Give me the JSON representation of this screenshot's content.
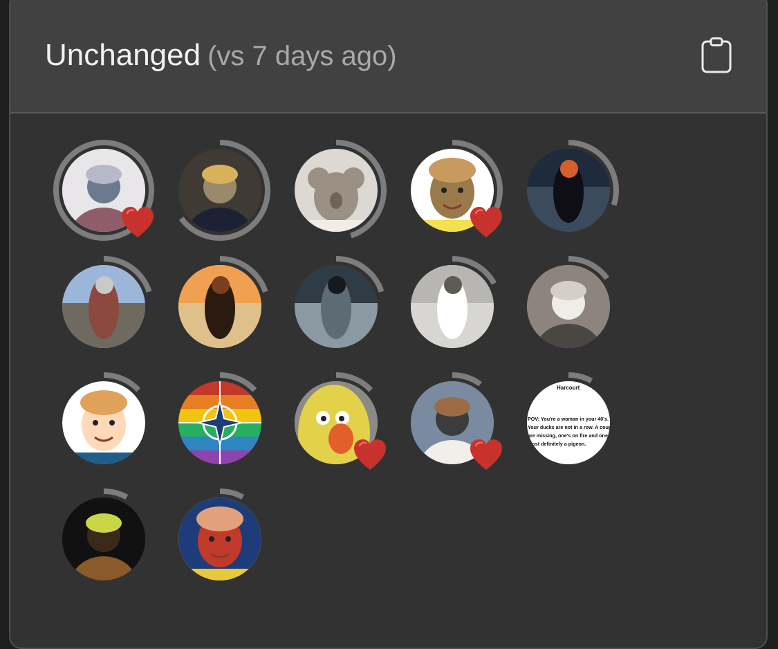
{
  "header": {
    "title": "Unchanged",
    "subtitle": "(vs 7 days ago)",
    "clipboard_icon": "clipboard-icon"
  },
  "colors": {
    "panel_bg": "#323232",
    "header_bg": "#414141",
    "ring_track": "#7d7d7d",
    "heart": "#c8322c"
  },
  "avatars": [
    {
      "ring": 1.0,
      "heart": true,
      "palette": [
        "#e9e6ea",
        "#8f5d69",
        "#b7b9c9",
        "#6b7a8f"
      ],
      "kind": "person"
    },
    {
      "ring": 0.65,
      "heart": false,
      "palette": [
        "#3f3b34",
        "#1c2233",
        "#d8b25a",
        "#9a8a6c"
      ],
      "kind": "person"
    },
    {
      "ring": 0.45,
      "heart": false,
      "palette": [
        "#dcd8d2",
        "#9c8f83",
        "#6e6259",
        "#ece8e3"
      ],
      "kind": "koala"
    },
    {
      "ring": 0.32,
      "heart": true,
      "palette": [
        "#f4e14e",
        "#ffffff",
        "#c89a5e",
        "#9a7a4a"
      ],
      "kind": "cartoon"
    },
    {
      "ring": 0.3,
      "heart": false,
      "palette": [
        "#1f2a3d",
        "#d6602a",
        "#0e0e14",
        "#3c4a5e"
      ],
      "kind": "scene"
    },
    {
      "ring": 0.2,
      "heart": false,
      "palette": [
        "#9bb6d8",
        "#c9c9c7",
        "#8b4a3d",
        "#6f6a60"
      ],
      "kind": "scene"
    },
    {
      "ring": 0.2,
      "heart": false,
      "palette": [
        "#f0a050",
        "#7a3f1e",
        "#2b1a10",
        "#e0c08a"
      ],
      "kind": "scene"
    },
    {
      "ring": 0.2,
      "heart": false,
      "palette": [
        "#2f3b45",
        "#151a1f",
        "#5c6b74",
        "#8b9aa2"
      ],
      "kind": "scene"
    },
    {
      "ring": 0.17,
      "heart": false,
      "palette": [
        "#b8b6b3",
        "#5e5a56",
        "#ffffff",
        "#d8d6d2"
      ],
      "kind": "scene"
    },
    {
      "ring": 0.15,
      "heart": false,
      "palette": [
        "#8d847d",
        "#4a4642",
        "#d6cfc6",
        "#f0ece6"
      ],
      "kind": "person"
    },
    {
      "ring": 0.13,
      "heart": false,
      "palette": [
        "#1f5e8a",
        "#ffffff",
        "#e0a25a",
        "#ffd9b8"
      ],
      "kind": "cartoon"
    },
    {
      "ring": 0.13,
      "heart": false,
      "palette": [
        "#c0392b",
        "#e67e22",
        "#f1c40f",
        "#2e86c1"
      ],
      "kind": "flag"
    },
    {
      "ring": 0.13,
      "heart": true,
      "palette": [
        "#e3d14a",
        "#e25e2a",
        "#ffffff",
        "#2d2d2d"
      ],
      "kind": "muppet"
    },
    {
      "ring": 0.1,
      "heart": true,
      "palette": [
        "#7a8aa0",
        "#f2eee8",
        "#9a6b45",
        "#3c3c3c"
      ],
      "kind": "person"
    },
    {
      "ring": 0.08,
      "heart": false,
      "palette": [
        "#ffffff",
        "#111111",
        "#555555",
        "#222222"
      ],
      "kind": "text",
      "text_lines": [
        "Harcourt",
        "POV: You're a woman in your 40's.",
        "Your ducks are not in a row. A couple",
        "are missing, one's on fire and one is",
        "most definitely a pigeon."
      ]
    },
    {
      "ring": 0.08,
      "heart": false,
      "palette": [
        "#111111",
        "#8a5a2a",
        "#c8d648",
        "#3b2a1a"
      ],
      "kind": "person"
    },
    {
      "ring": 0.08,
      "heart": false,
      "palette": [
        "#e7c93a",
        "#1f3c7a",
        "#e2a17a",
        "#c0392b"
      ],
      "kind": "cartoon"
    }
  ]
}
